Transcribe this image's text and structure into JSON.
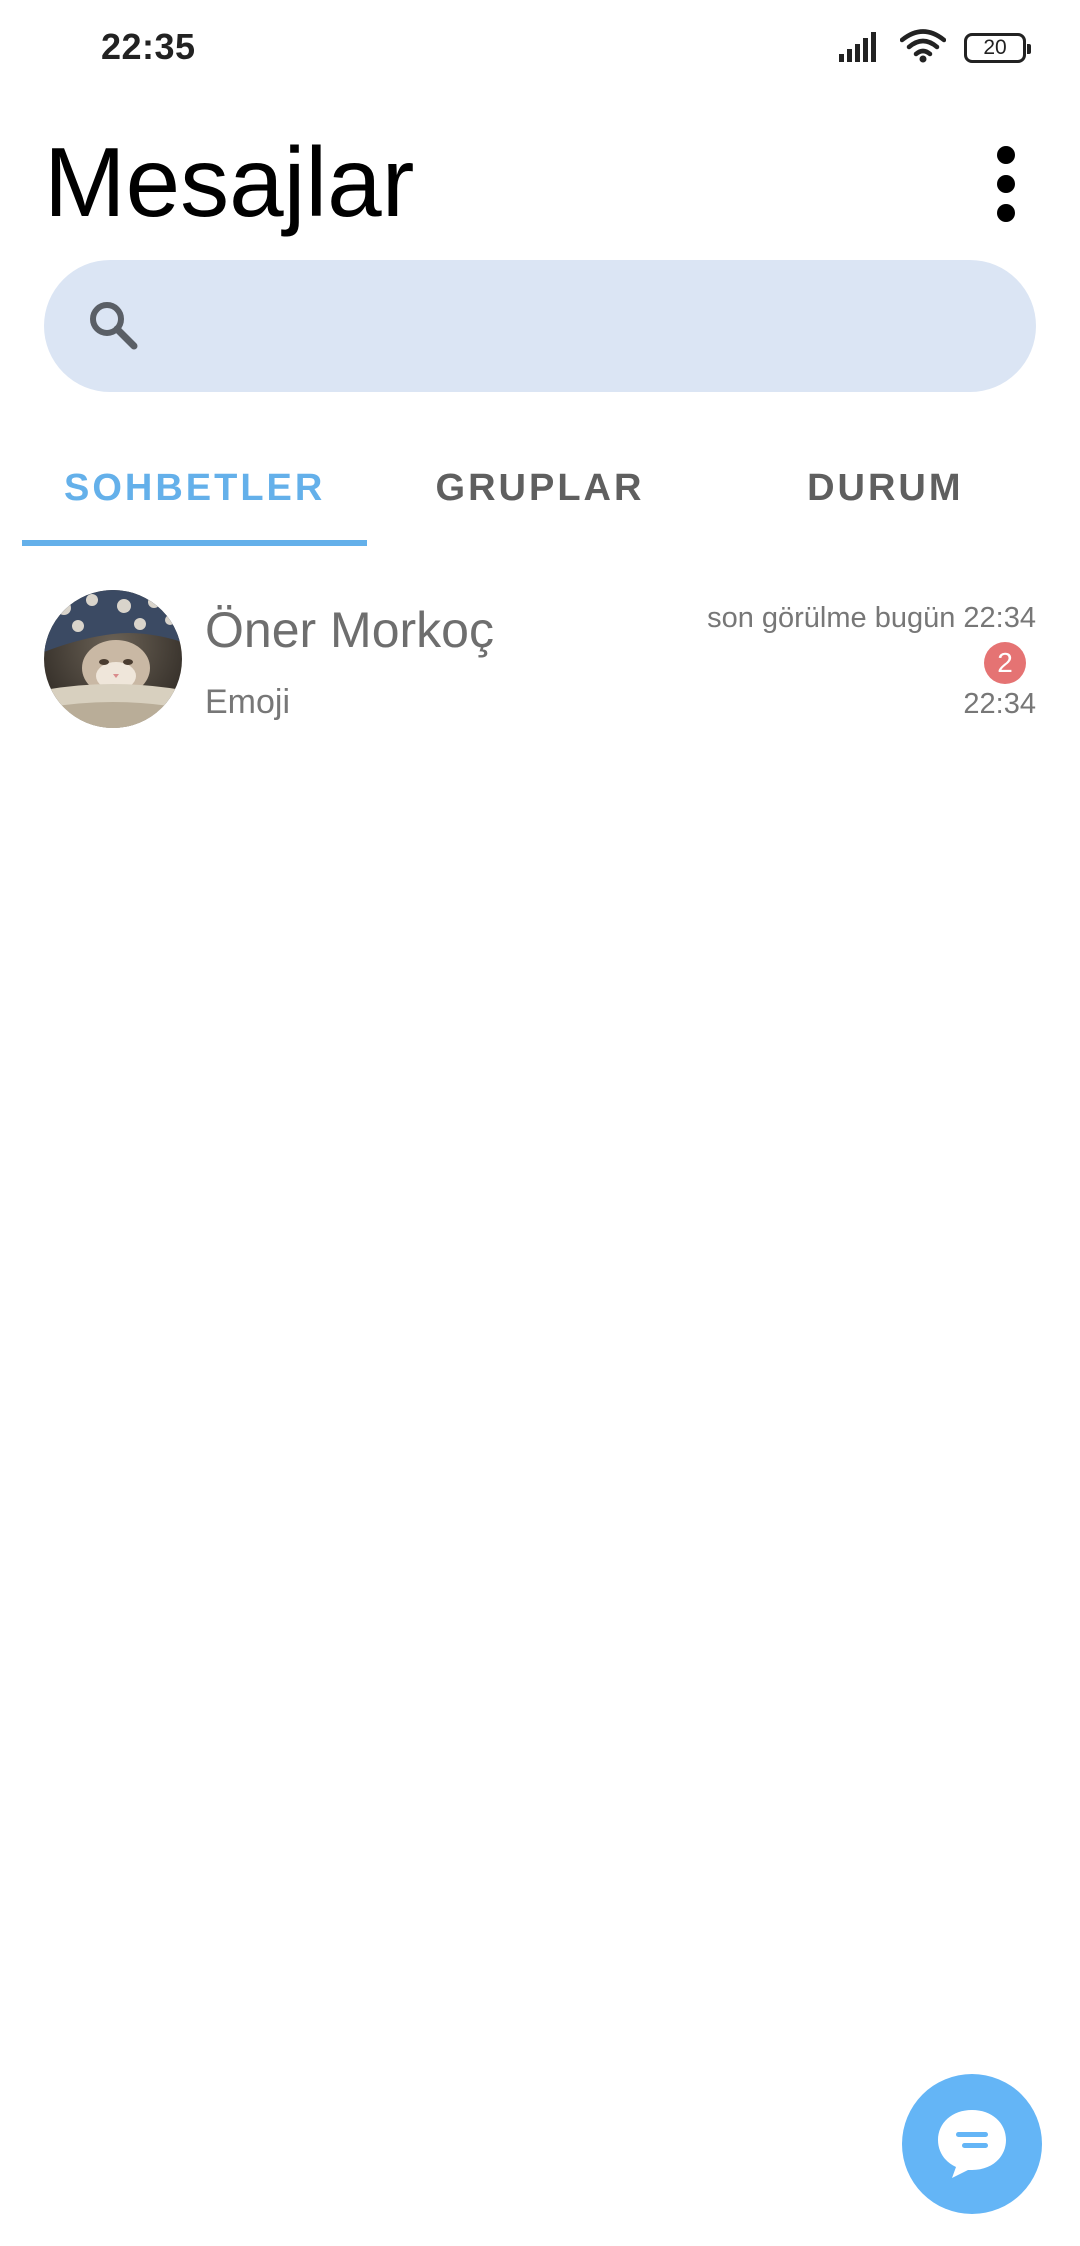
{
  "status_bar": {
    "time": "22:35",
    "battery": "20",
    "icons": [
      "signal-icon",
      "wifi-icon",
      "battery-icon"
    ]
  },
  "header": {
    "title": "Mesajlar",
    "menu_icon": "more-vert-icon"
  },
  "search": {
    "icon": "search-icon",
    "placeholder": "",
    "value": ""
  },
  "tabs": [
    {
      "label": "SOHBETLER",
      "active": true
    },
    {
      "label": "GRUPLAR",
      "active": false
    },
    {
      "label": "DURUM",
      "active": false
    }
  ],
  "chats": [
    {
      "name": "Öner Morkoç",
      "preview": "Emoji",
      "last_seen": "son görülme bugün 22:34",
      "unread": "2",
      "time": "22:34"
    }
  ],
  "fab": {
    "icon": "new-chat-icon"
  },
  "colors": {
    "accent": "#64b0ea",
    "search_bg": "#dbe5f4",
    "badge": "#e57373",
    "fab": "#64b5f6"
  }
}
